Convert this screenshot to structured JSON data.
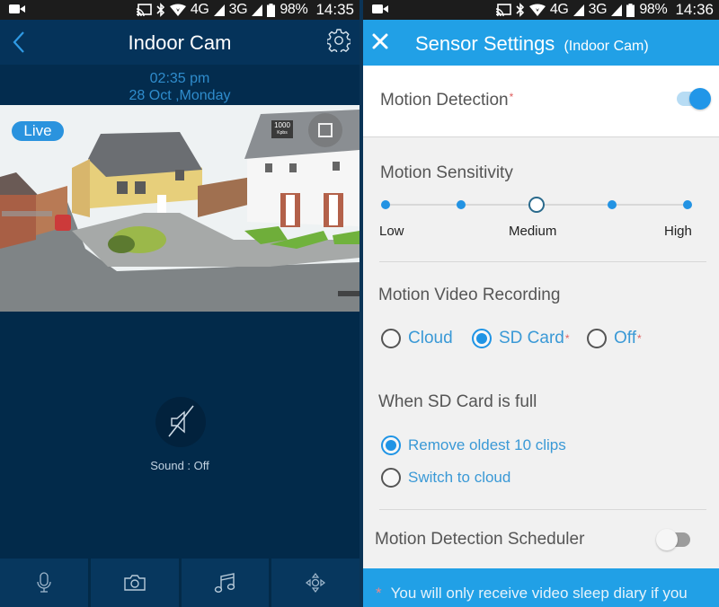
{
  "left_screen": {
    "status_bar": {
      "notification_icon": "video-camera-icon",
      "icons": [
        "cast-icon",
        "bluetooth-icon",
        "wifi-icon"
      ],
      "network_1": "4G",
      "network_2": "3G",
      "battery": "98%",
      "time": "14:35"
    },
    "header": {
      "title": "Indoor Cam",
      "back_icon": "chevron-left-icon",
      "settings_icon": "gear-icon"
    },
    "datetime": {
      "time": "02:35 pm",
      "date": "28 Oct ,Monday"
    },
    "video": {
      "live_label": "Live",
      "bitrate_value": "1000",
      "bitrate_unit": "Kpbs",
      "fullscreen_icon": "fullscreen-icon"
    },
    "sound": {
      "icon": "speaker-muted-icon",
      "label": "Sound : Off"
    },
    "toolbar": [
      {
        "name": "microphone",
        "icon": "microphone-icon"
      },
      {
        "name": "snapshot",
        "icon": "camera-icon"
      },
      {
        "name": "lullaby",
        "icon": "music-note-icon"
      },
      {
        "name": "pan-tilt",
        "icon": "directional-pad-icon"
      }
    ]
  },
  "right_screen": {
    "status_bar": {
      "notification_icon": "video-camera-icon",
      "icons": [
        "cast-icon",
        "bluetooth-icon",
        "wifi-icon"
      ],
      "network_1": "4G",
      "network_2": "3G",
      "battery": "98%",
      "time": "14:36"
    },
    "header": {
      "close_icon": "close-icon",
      "title": "Sensor Settings",
      "subtitle": "(Indoor Cam)"
    },
    "motion_detection": {
      "label": "Motion Detection",
      "asterisk": "*",
      "enabled": true
    },
    "motion_sensitivity": {
      "label": "Motion Sensitivity",
      "levels": 5,
      "selected_index": 2,
      "tick_labels": [
        "Low",
        "Medium",
        "High"
      ]
    },
    "motion_video_recording": {
      "label": "Motion Video Recording",
      "options": [
        {
          "label": "Cloud",
          "asterisk": "",
          "checked": false
        },
        {
          "label": "SD Card",
          "asterisk": "*",
          "checked": true
        },
        {
          "label": "Off",
          "asterisk": "*",
          "checked": false
        }
      ]
    },
    "sd_card_full": {
      "label": "When SD Card is full",
      "options": [
        {
          "label": "Remove oldest 10 clips",
          "checked": true
        },
        {
          "label": "Switch to cloud",
          "checked": false
        }
      ]
    },
    "scheduler": {
      "label": "Motion Detection Scheduler",
      "enabled": false
    },
    "footer_note": {
      "asterisk": "*",
      "text": "You will only receive video sleep diary if you"
    }
  },
  "colors": {
    "left_bg": "#022a4a",
    "left_header": "#05335a",
    "accent_blue": "#21a0e6",
    "link_blue": "#3a99d6",
    "asterisk_red": "#e06060"
  }
}
